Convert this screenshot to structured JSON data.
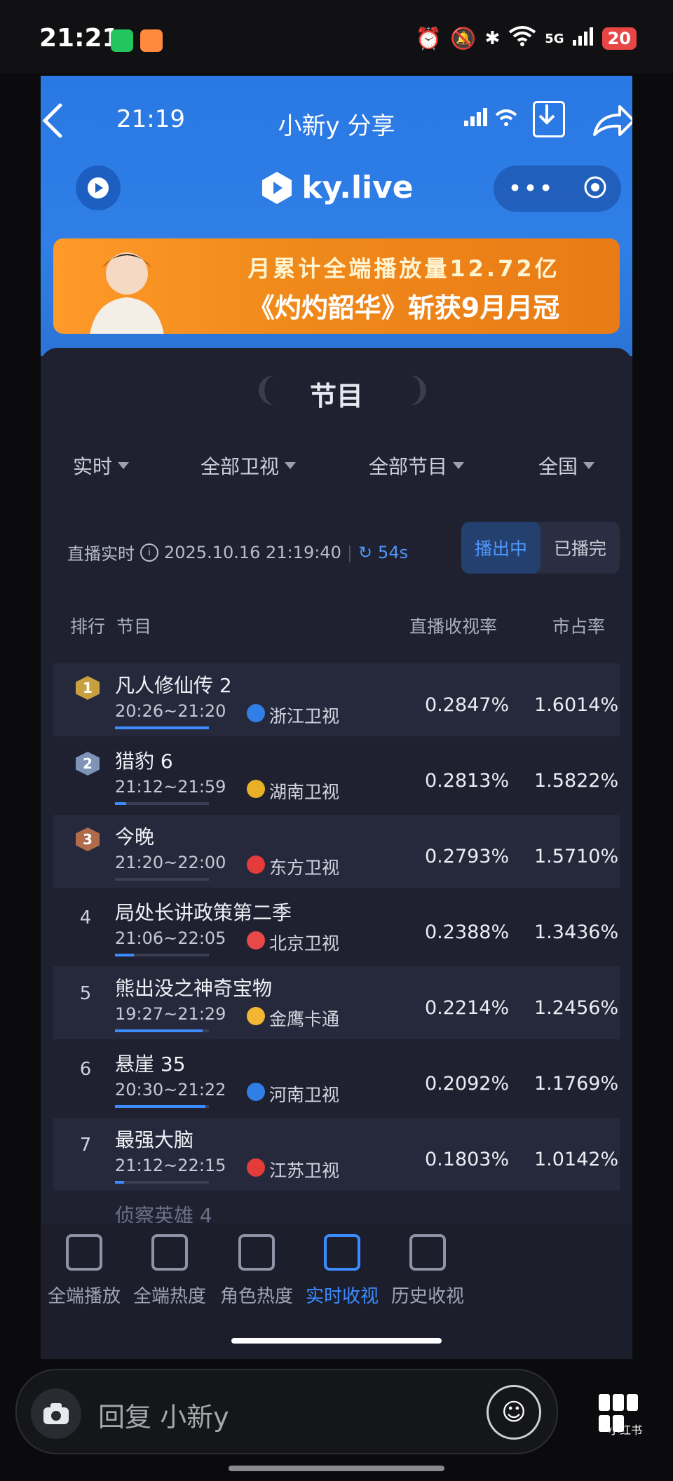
{
  "outer_status": {
    "time": "21:21",
    "network": "5G",
    "battery": "20"
  },
  "inner_header": {
    "time": "21:19",
    "title": "小新y 分享",
    "logo_text": "ky.live"
  },
  "banner": {
    "line1": "月累计全端播放量12.72亿",
    "line2": "《灼灼韶华》斩获9月月冠"
  },
  "section_title": "节目",
  "filters": [
    "实时",
    "全部卫视",
    "全部节目",
    "全国"
  ],
  "live": {
    "label": "直播实时",
    "timestamp": "2025.10.16 21:19:40",
    "countdown": "54s"
  },
  "toggle": {
    "live": "播出中",
    "done": "已播完"
  },
  "table": {
    "headers": {
      "rank": "排行",
      "program": "节目",
      "rating": "直播收视率",
      "share": "市占率"
    },
    "rows": [
      {
        "rank": "1",
        "program": "凡人修仙传 2",
        "time": "20:26~21:20",
        "channel": "浙江卫视",
        "rating": "0.2847%",
        "share": "1.6014%",
        "progress": 1.0,
        "channel_color": "#2f7fe6",
        "medal_color": "#c9a040"
      },
      {
        "rank": "2",
        "program": "猎豹 6",
        "time": "21:12~21:59",
        "channel": "湖南卫视",
        "rating": "0.2813%",
        "share": "1.5822%",
        "progress": 0.12,
        "channel_color": "#e8b026",
        "medal_color": "#7f93b6"
      },
      {
        "rank": "3",
        "program": "今晚",
        "time": "21:20~22:00",
        "channel": "东方卫视",
        "rating": "0.2793%",
        "share": "1.5710%",
        "progress": 0.0,
        "channel_color": "#e43b3b",
        "medal_color": "#b06b4a"
      },
      {
        "rank": "4",
        "program": "局处长讲政策第二季",
        "time": "21:06~22:05",
        "channel": "北京卫视",
        "rating": "0.2388%",
        "share": "1.3436%",
        "progress": 0.2,
        "channel_color": "#e94848"
      },
      {
        "rank": "5",
        "program": "熊出没之神奇宝物",
        "time": "19:27~21:29",
        "channel": "金鹰卡通",
        "rating": "0.2214%",
        "share": "1.2456%",
        "progress": 0.93,
        "channel_color": "#f2b632"
      },
      {
        "rank": "6",
        "program": "悬崖 35",
        "time": "20:30~21:22",
        "channel": "河南卫视",
        "rating": "0.2092%",
        "share": "1.1769%",
        "progress": 0.96,
        "channel_color": "#2f7fe6"
      },
      {
        "rank": "7",
        "program": "最强大脑",
        "time": "21:12~22:15",
        "channel": "江苏卫视",
        "rating": "0.1803%",
        "share": "1.0142%",
        "progress": 0.1,
        "channel_color": "#e43b3b"
      }
    ],
    "peek": "侦察英雄 4"
  },
  "tabs": [
    "全端播放",
    "全端热度",
    "角色热度",
    "实时收视",
    "历史收视"
  ],
  "active_tab": "实时收视",
  "reply": {
    "placeholder": "回复 小新y"
  },
  "watermark": "小红书",
  "colors": {
    "accent": "#3c8cff",
    "header_blue": "#2f7fe6",
    "panel": "#1f2131",
    "banner_orange": "#f08a1b"
  }
}
